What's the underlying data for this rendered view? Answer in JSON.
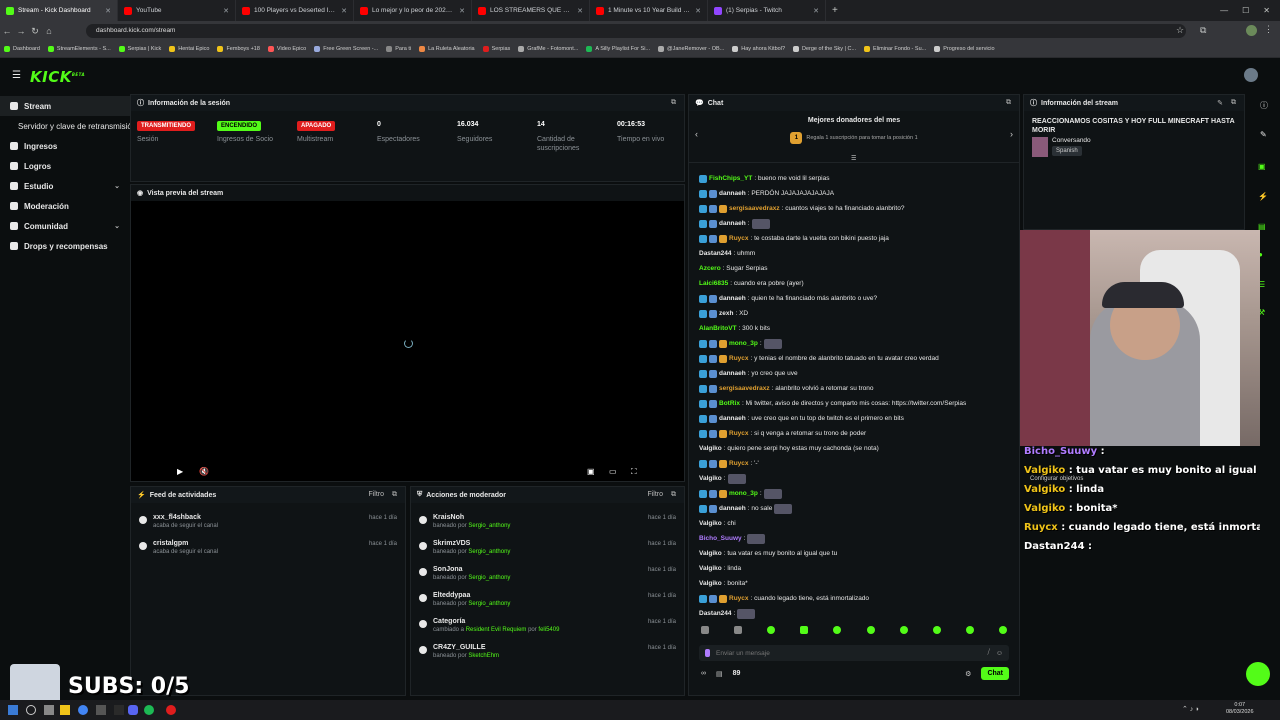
{
  "browser": {
    "tabs": [
      {
        "title": "Stream - Kick Dashboard",
        "color": "#53fc18",
        "active": true
      },
      {
        "title": "YouTube",
        "color": "#ff0000"
      },
      {
        "title": "100 Players vs Deserted Island",
        "color": "#ff0000"
      },
      {
        "title": "Lo mejor y lo peor de 2025 #6",
        "color": "#ff0000"
      },
      {
        "title": "LOS STREAMERS QUE ODIAN A",
        "color": "#ff0000"
      },
      {
        "title": "1 Minute vs 10 Year Build Chall",
        "color": "#ff0000"
      },
      {
        "title": "(1) Serpias - Twitch",
        "color": "#9146ff"
      }
    ],
    "url": "dashboard.kick.com/stream",
    "bookmarks": [
      "Dashboard",
      "StreamElements - S...",
      "Serpias | Kick",
      "Hentai Epico",
      "Femboys +18",
      "Video Epico",
      "Free Green Screen -...",
      "Para ti",
      "La Ruleta Aleatoria",
      "Serpias",
      "GrafMe - Fotomont...",
      "A Silly Playlist For Si...",
      "@JaneRemover - OB...",
      "Hay ahora Kitbol?",
      "Derge of the Sky | C...",
      "Eliminar Fondo - Su...",
      "Progreso del servicio"
    ]
  },
  "kick": {
    "logo": "KICK",
    "logo_sup": "BETA"
  },
  "sidebar": {
    "items": [
      {
        "label": "Stream",
        "active": true
      },
      {
        "label": "Servidor y clave de retransmisión",
        "sub": true
      },
      {
        "label": "Ingresos"
      },
      {
        "label": "Logros"
      },
      {
        "label": "Estudio",
        "chevron": true
      },
      {
        "label": "Moderación"
      },
      {
        "label": "Comunidad",
        "chevron": true
      },
      {
        "label": "Drops y recompensas"
      }
    ]
  },
  "session": {
    "title": "Información de la sesión",
    "stats": [
      {
        "value": "TRANSMITIENDO",
        "label": "Sesión",
        "pill": "#e01d1d"
      },
      {
        "value": "ENCENDIDO",
        "label": "Ingresos de Socio",
        "pill": "#53fc18"
      },
      {
        "value": "APAGADO",
        "label": "Multistream",
        "pill": "#e01d1d"
      },
      {
        "value": "0",
        "label": "Espectadores"
      },
      {
        "value": "16.034",
        "label": "Seguidores"
      },
      {
        "value": "14",
        "label": "Cantidad de suscripciones"
      },
      {
        "value": "00:16:53",
        "label": "Tiempo en vivo"
      }
    ]
  },
  "preview": {
    "title": "Vista previa del stream"
  },
  "activity": {
    "title": "Feed de actividades",
    "filter": "Filtro",
    "items": [
      {
        "user": "xxx_fl4shback",
        "action": "acaba de seguir el canal",
        "time": "hace 1 día"
      },
      {
        "user": "cristalgpm",
        "action": "acaba de seguir el canal",
        "time": "hace 1 día"
      }
    ]
  },
  "modactions": {
    "title": "Acciones de moderador",
    "filter": "Filtro",
    "items": [
      {
        "user": "KraisNoh",
        "action": "baneado por",
        "by": "Sergio_anthony",
        "time": "hace 1 día"
      },
      {
        "user": "SkrimzVDS",
        "action": "baneado por",
        "by": "Sergio_anthony",
        "time": "hace 1 día"
      },
      {
        "user": "SonJona",
        "action": "baneado por",
        "by": "Sergio_anthony",
        "time": "hace 1 día"
      },
      {
        "user": "Elteddypaa",
        "action": "baneado por",
        "by": "Sergio_anthony",
        "time": "hace 1 día"
      },
      {
        "user": "Categoría",
        "action": "cambiado a",
        "by": "Resident Evil Requiem",
        "extra": "por",
        "by2": "feli5409",
        "time": "hace 1 día"
      },
      {
        "user": "CR4ZY_GUILLE",
        "action": "baneado por",
        "by": "SketchEhm",
        "time": "hace 1 día"
      }
    ]
  },
  "chat": {
    "title": "Chat",
    "top_donors": "Mejores donadores del mes",
    "donor_hint": "Regala 1 suscripción para tomar la posición 1",
    "donor_rank": "1",
    "messages": [
      {
        "user": "FishChips_YT",
        "color": "#53fc18",
        "text": ": bueno me void lil serpias",
        "badges": 1
      },
      {
        "user": "dannaeh",
        "color": "#e8e8e8",
        "text": ": PERDÓN JAJAJAJAJAJAJA",
        "badges": 2
      },
      {
        "user": "sergisaavedraxz",
        "color": "#e0a030",
        "text": ": cuantos viajes te ha financiado alanbrito?",
        "badges": 3
      },
      {
        "user": "dannaeh",
        "color": "#e8e8e8",
        "text": ":",
        "badges": 2,
        "emote": true
      },
      {
        "user": "Ruycx",
        "color": "#e0a030",
        "text": ": te costaba darte la vuelta con bikini puesto jaja",
        "badges": 3
      },
      {
        "user": "Dastan244",
        "color": "#e8e8e8",
        "text": ": uhmm",
        "badges": 0
      },
      {
        "user": "Azcero",
        "color": "#53fc18",
        "text": ": Sugar Serpias",
        "badges": 0
      },
      {
        "user": "Laici6835",
        "color": "#53fc18",
        "text": ": cuando era pobre (ayer)",
        "badges": 0
      },
      {
        "user": "dannaeh",
        "color": "#e8e8e8",
        "text": ": quien te ha financiado más alanbrito o uve?",
        "badges": 2
      },
      {
        "user": "zexh",
        "color": "#e8e8e8",
        "text": ": XD",
        "badges": 2
      },
      {
        "user": "AlanBritoVT",
        "color": "#53fc18",
        "text": ": 300 k bits",
        "badges": 0
      },
      {
        "user": "mono_3p",
        "color": "#53fc18",
        "text": ":",
        "badges": 3,
        "emote": true
      },
      {
        "user": "Ruycx",
        "color": "#e0a030",
        "text": ": y tenias el nombre de alanbrito tatuado en tu avatar creo verdad",
        "badges": 3
      },
      {
        "user": "dannaeh",
        "color": "#e8e8e8",
        "text": ": yo creo que uve",
        "badges": 2
      },
      {
        "user": "sergisaavedraxz",
        "color": "#e0a030",
        "text": ": alanbrito volvió a retomar su trono",
        "badges": 2
      },
      {
        "user": "BotRix",
        "color": "#53fc18",
        "text": ": Mi twitter, aviso de directos y comparto mis cosas: https://twitter.com/Serpias",
        "badges": 2
      },
      {
        "user": "dannaeh",
        "color": "#e8e8e8",
        "text": ": uve creo que en tu top de twitch es el primero en bits",
        "badges": 2
      },
      {
        "user": "Ruycx",
        "color": "#e0a030",
        "text": ": si q venga a retomar su trono de poder",
        "badges": 3
      },
      {
        "user": "Valgiko",
        "color": "#e8e8e8",
        "text": ": quiero pene      serpi hoy estas muy cachonda (se nota)",
        "badges": 0
      },
      {
        "user": "Ruycx",
        "color": "#e0a030",
        "text": ": '-'",
        "badges": 3
      },
      {
        "user": "Valgiko",
        "color": "#e8e8e8",
        "text": ":",
        "badges": 0,
        "emote": true
      },
      {
        "user": "mono_3p",
        "color": "#53fc18",
        "text": ":",
        "badges": 3,
        "emote": true
      },
      {
        "user": "dannaeh",
        "color": "#e8e8e8",
        "text": ": no sale",
        "badges": 2,
        "emote": true
      },
      {
        "user": "Valgiko",
        "color": "#e8e8e8",
        "text": ": chi",
        "badges": 0
      },
      {
        "user": "Bicho_Suuwy",
        "color": "#b07cff",
        "text": ":",
        "badges": 0,
        "emote": true
      },
      {
        "user": "Valgiko",
        "color": "#e8e8e8",
        "text": ": tua vatar es muy bonito al igual que tu",
        "badges": 0
      },
      {
        "user": "Valgiko",
        "color": "#e8e8e8",
        "text": ": linda",
        "badges": 0
      },
      {
        "user": "Valgiko",
        "color": "#e8e8e8",
        "text": ": bonita*",
        "badges": 0
      },
      {
        "user": "Ruycx",
        "color": "#e0a030",
        "text": ": cuando legado tiene, está inmortalizado",
        "badges": 3
      },
      {
        "user": "Dastan244",
        "color": "#e8e8e8",
        "text": ":",
        "badges": 0,
        "emote": true
      }
    ],
    "input_placeholder": "Enviar un mensaje",
    "viewer_count": "89",
    "send_button": "Chat"
  },
  "stream_info": {
    "title": "Información del stream",
    "stream_title": "REACCIONAMOS COSITAS Y HOY FULL MINECRAFT HASTA MORIR",
    "category": "Conversando",
    "language": "Spanish"
  },
  "overlay": {
    "chat": [
      {
        "user": "Bicho_Suuwy",
        "color": "#b07cff",
        "text": " :"
      },
      {
        "user": "Valgiko",
        "color": "#f0c419",
        "text": " : tua vatar es muy bonito al igual que tu"
      },
      {
        "user": "Valgiko",
        "color": "#f0c419",
        "text": " : linda"
      },
      {
        "user": "Valgiko",
        "color": "#f0c419",
        "text": " : bonita*"
      },
      {
        "user": "Ruycx",
        "color": "#f0c419",
        "text": " : cuando legado tiene, está inmortalizado"
      },
      {
        "user": "Dastan244",
        "color": "#ffffff",
        "text": " :"
      }
    ],
    "configure": "Configurar objetivos",
    "subs": "SUBS: 0/5"
  },
  "taskbar": {
    "time": "0:07",
    "date": "08/03/2026"
  }
}
